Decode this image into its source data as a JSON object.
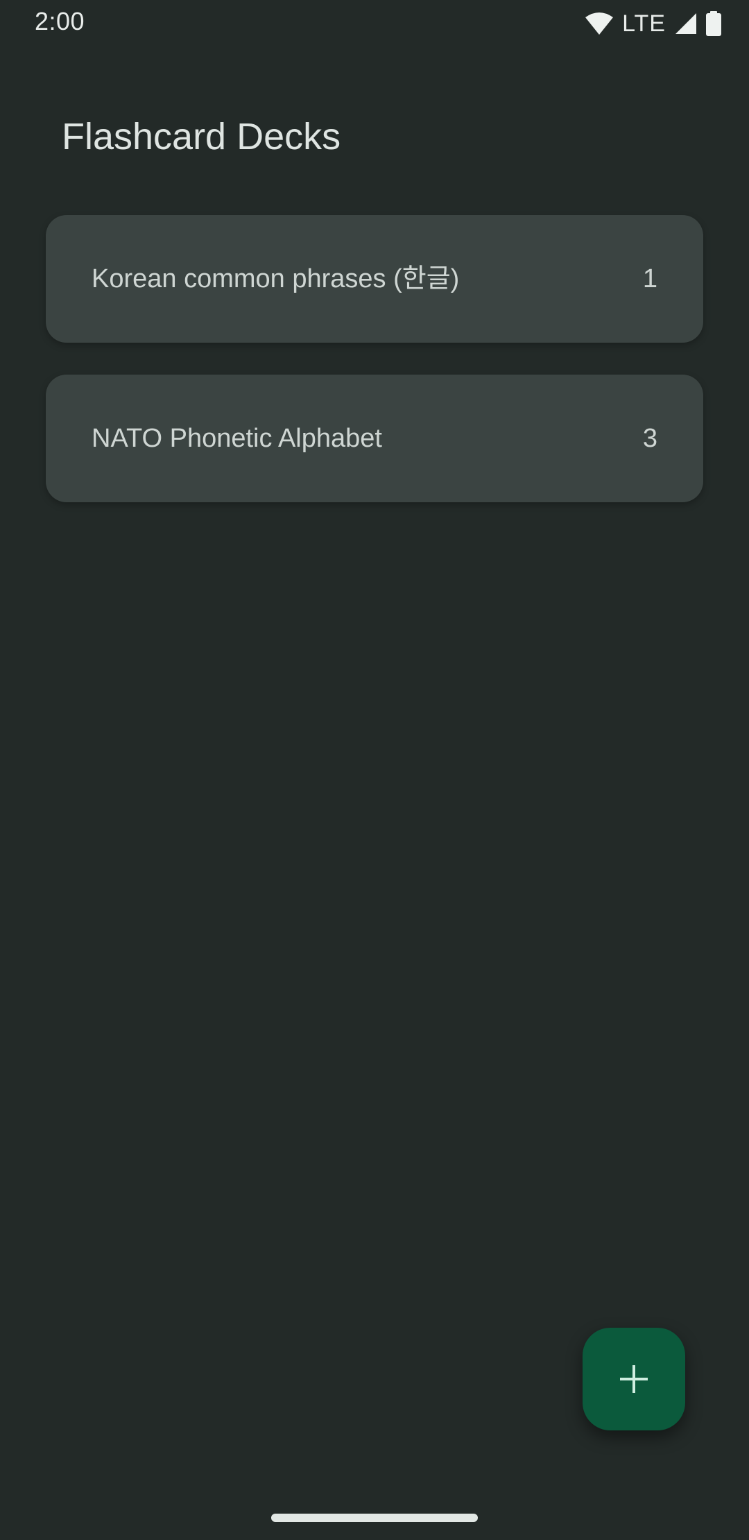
{
  "status_bar": {
    "time": "2:00",
    "network": "LTE",
    "icons": [
      "wifi-icon",
      "cell-signal-icon",
      "battery-icon"
    ]
  },
  "page": {
    "title": "Flashcard Decks"
  },
  "decks": [
    {
      "name": "Korean common phrases (한글)",
      "count": "1"
    },
    {
      "name": "NATO Phonetic Alphabet",
      "count": "3"
    }
  ],
  "fab": {
    "icon": "plus-icon",
    "color": "#0b5a3c"
  },
  "colors": {
    "background": "#232a28",
    "card": "#3b4442",
    "accent": "#0b5a3c"
  }
}
